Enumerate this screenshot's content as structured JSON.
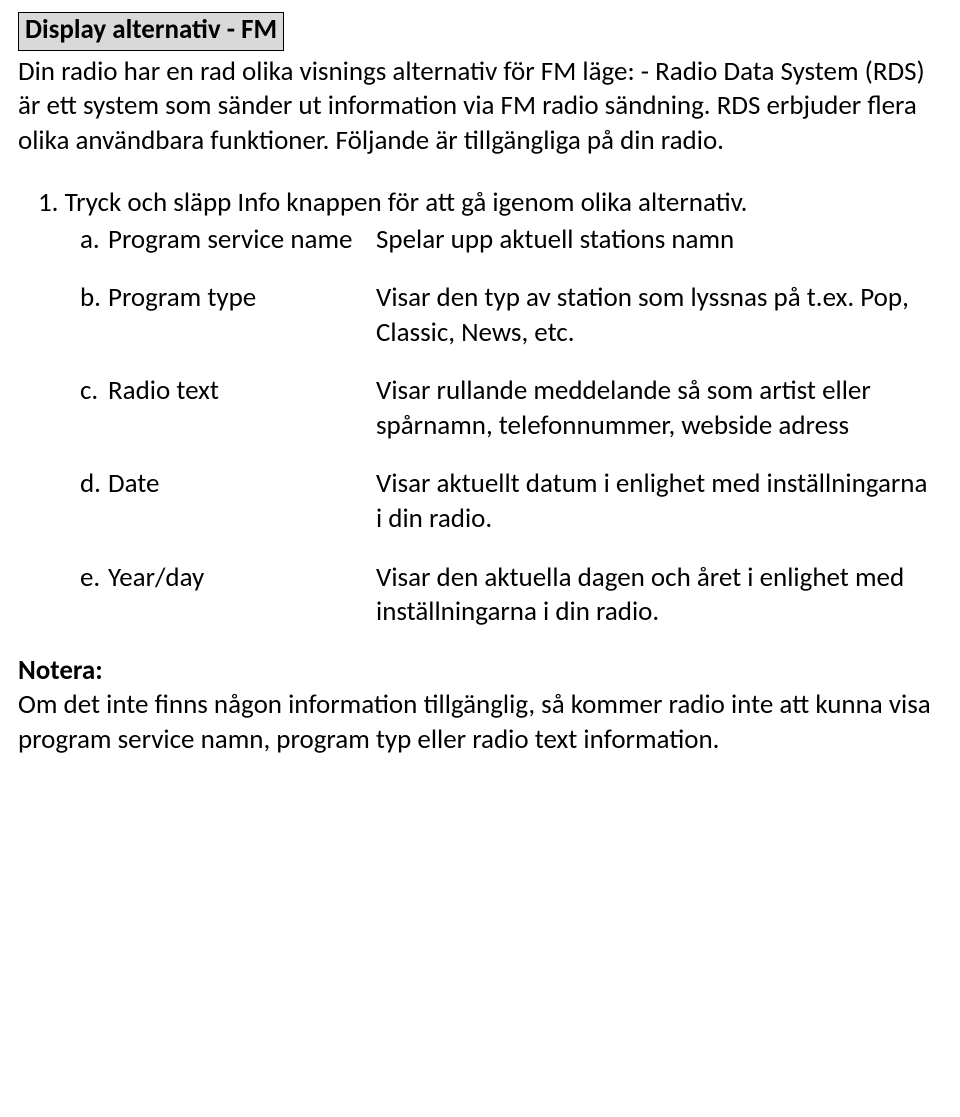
{
  "heading": "Display alternativ - FM",
  "intro": "Din radio har en rad olika visnings alternativ för FM läge: - Radio Data System (RDS) är ett system som sänder ut information via FM radio sändning. RDS erbjuder flera olika användbara funktioner. Följande är tillgängliga på din radio.",
  "step1_number": "1.",
  "step1_text": "Tryck och släpp Info knappen för att gå igenom olika alternativ.",
  "items": {
    "a": {
      "letter": "a.",
      "label": "Program service name",
      "desc": "Spelar upp aktuell stations namn"
    },
    "b": {
      "letter": "b.",
      "label": "Program type",
      "desc": "Visar den typ av station som lyssnas på t.ex. Pop, Classic, News, etc."
    },
    "c": {
      "letter": "c.",
      "label": "Radio text",
      "desc": "Visar rullande meddelande så som artist eller spårnamn, telefonnummer, webside adress"
    },
    "d": {
      "letter": "d.",
      "label": "Date",
      "desc": "Visar aktuellt datum i enlighet med inställningarna i din radio."
    },
    "e": {
      "letter": "e.",
      "label": "Year/day",
      "desc": "Visar den aktuella dagen och året i enlighet med inställningarna i din radio."
    }
  },
  "note": {
    "heading": "Notera:",
    "body": "Om det inte finns någon information tillgänglig, så kommer radio inte att kunna visa program service namn, program typ eller radio text information."
  }
}
